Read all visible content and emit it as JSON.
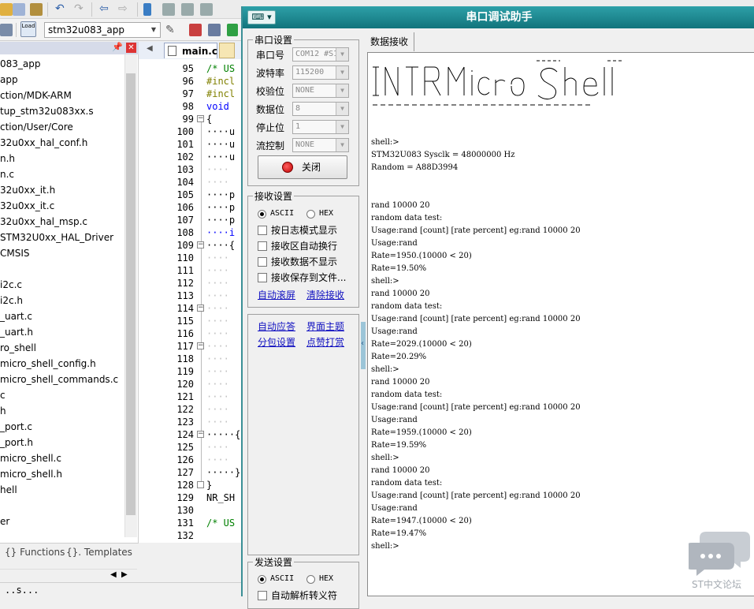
{
  "ide": {
    "target_combo": "stm32u083_app",
    "editor_tab": "main.c",
    "project_items": [
      "083_app",
      "app",
      "ction/MDK-ARM",
      "tup_stm32u083xx.s",
      "ction/User/Core",
      "32u0xx_hal_conf.h",
      "n.h",
      "n.c",
      "32u0xx_it.h",
      "32u0xx_it.c",
      "32u0xx_hal_msp.c",
      "STM32U0xx_HAL_Driver",
      "CMSIS",
      "",
      "i2c.c",
      "i2c.h",
      "_uart.c",
      "_uart.h",
      "ro_shell",
      "micro_shell_config.h",
      "micro_shell_commands.c",
      "c",
      "h",
      "_port.c",
      "_port.h",
      "micro_shell.c",
      "micro_shell.h",
      "hell",
      "",
      "er"
    ],
    "bottom_tabs": {
      "functions": "Functions",
      "templates": "Templates"
    },
    "line_numbers": [
      "95",
      "96",
      "97",
      "98",
      "99",
      "100",
      "101",
      "102",
      "103",
      "104",
      "105",
      "106",
      "107",
      "108",
      "109",
      "110",
      "111",
      "112",
      "113",
      "114",
      "115",
      "116",
      "117",
      "118",
      "119",
      "120",
      "121",
      "122",
      "123",
      "124",
      "125",
      "126",
      "127",
      "128",
      "129",
      "130",
      "131",
      "132"
    ],
    "code_lines": [
      {
        "text": "/* US",
        "color": "#008000"
      },
      {
        "text": "#incl",
        "color": "#808000"
      },
      {
        "text": "#incl",
        "color": "#808000"
      },
      {
        "text": "void ",
        "color": "#0000ff"
      },
      {
        "text": "{",
        "color": "#000000"
      },
      {
        "text": "····u",
        "color": "#000000"
      },
      {
        "text": "····u",
        "color": "#000000"
      },
      {
        "text": "····u",
        "color": "#000000"
      },
      {
        "text": "····",
        "color": "#c0c0c0"
      },
      {
        "text": "····",
        "color": "#c0c0c0"
      },
      {
        "text": "····p",
        "color": "#000000"
      },
      {
        "text": "····p",
        "color": "#000000"
      },
      {
        "text": "····p",
        "color": "#000000"
      },
      {
        "text": "····i",
        "color": "#0000ff"
      },
      {
        "text": "····{",
        "color": "#000000"
      },
      {
        "text": "····",
        "color": "#c0c0c0"
      },
      {
        "text": "····",
        "color": "#c0c0c0"
      },
      {
        "text": "····",
        "color": "#c0c0c0"
      },
      {
        "text": "····",
        "color": "#c0c0c0"
      },
      {
        "text": "····",
        "color": "#c0c0c0"
      },
      {
        "text": "····",
        "color": "#c0c0c0"
      },
      {
        "text": "····",
        "color": "#c0c0c0"
      },
      {
        "text": "····",
        "color": "#c0c0c0"
      },
      {
        "text": "····",
        "color": "#c0c0c0"
      },
      {
        "text": "····",
        "color": "#c0c0c0"
      },
      {
        "text": "····",
        "color": "#c0c0c0"
      },
      {
        "text": "····",
        "color": "#c0c0c0"
      },
      {
        "text": "····",
        "color": "#c0c0c0"
      },
      {
        "text": "····",
        "color": "#c0c0c0"
      },
      {
        "text": "·····{",
        "color": "#000000"
      },
      {
        "text": "····",
        "color": "#c0c0c0"
      },
      {
        "text": "····",
        "color": "#c0c0c0"
      },
      {
        "text": "·····}",
        "color": "#000000"
      },
      {
        "text": "}",
        "color": "#000000"
      },
      {
        "text": "NR_SH",
        "color": "#000000"
      },
      {
        "text": "",
        "color": "#000000"
      },
      {
        "text": "/* US",
        "color": "#008000"
      },
      {
        "text": "",
        "color": "#000000"
      }
    ],
    "status_text": "..s..."
  },
  "serial": {
    "title": "串口调试助手",
    "port_settings": {
      "group": "串口设置",
      "port_label": "串口号",
      "port_value": "COM12 #S1",
      "baud_label": "波特率",
      "baud_value": "115200",
      "parity_label": "校验位",
      "parity_value": "NONE",
      "databits_label": "数据位",
      "databits_value": "8",
      "stopbits_label": "停止位",
      "stopbits_value": "1",
      "flow_label": "流控制",
      "flow_value": "NONE",
      "close_button": "关闭"
    },
    "recv_settings": {
      "group": "接收设置",
      "ascii": "ASCII",
      "hex": "HEX",
      "opt_log": "按日志模式显示",
      "opt_wrap": "接收区自动换行",
      "opt_hide": "接收数据不显示",
      "opt_save": "接收保存到文件...",
      "auto_scroll": "自动滚屏",
      "clear": "清除接收"
    },
    "misc": {
      "auto_reply": "自动应答",
      "theme": "界面主题",
      "packet": "分包设置",
      "tip": "点赞打赏"
    },
    "send_settings": {
      "group": "发送设置",
      "ascii": "ASCII",
      "hex": "HEX",
      "opt_escape": "自动解析转义符"
    },
    "recv_tab": "数据接收",
    "recv_lines": [
      "shell:>",
      "STM32U083 Sysclk = 48000000 Hz",
      "Random = A88D3994",
      "",
      "",
      "rand 10000 20",
      "random data test:",
      "Usage:rand [count] [rate percent] eg:rand 10000 20",
      "Usage:rand",
      "Rate=1950.(10000 < 20)",
      "Rate=19.50%",
      "shell:>",
      "rand 10000 20",
      "random data test:",
      "Usage:rand [count] [rate percent] eg:rand 10000 20",
      "Usage:rand",
      "Rate=2029.(10000 < 20)",
      "Rate=20.29%",
      "shell:>",
      "rand 10000 20",
      "random data test:",
      "Usage:rand [count] [rate percent] eg:rand 10000 20",
      "Usage:rand",
      "Rate=1959.(10000 < 20)",
      "Rate=19.59%",
      "shell:>",
      "rand 10000 20",
      "random data test:",
      "Usage:rand [count] [rate percent] eg:rand 10000 20",
      "Usage:rand",
      "Rate=1947.(10000 < 20)",
      "Rate=19.47%",
      "shell:>"
    ]
  },
  "watermark": "ST中文论坛",
  "colors": {
    "title_bar": "#1a8a92",
    "link": "#1010c0",
    "close_led": "#e00000"
  }
}
